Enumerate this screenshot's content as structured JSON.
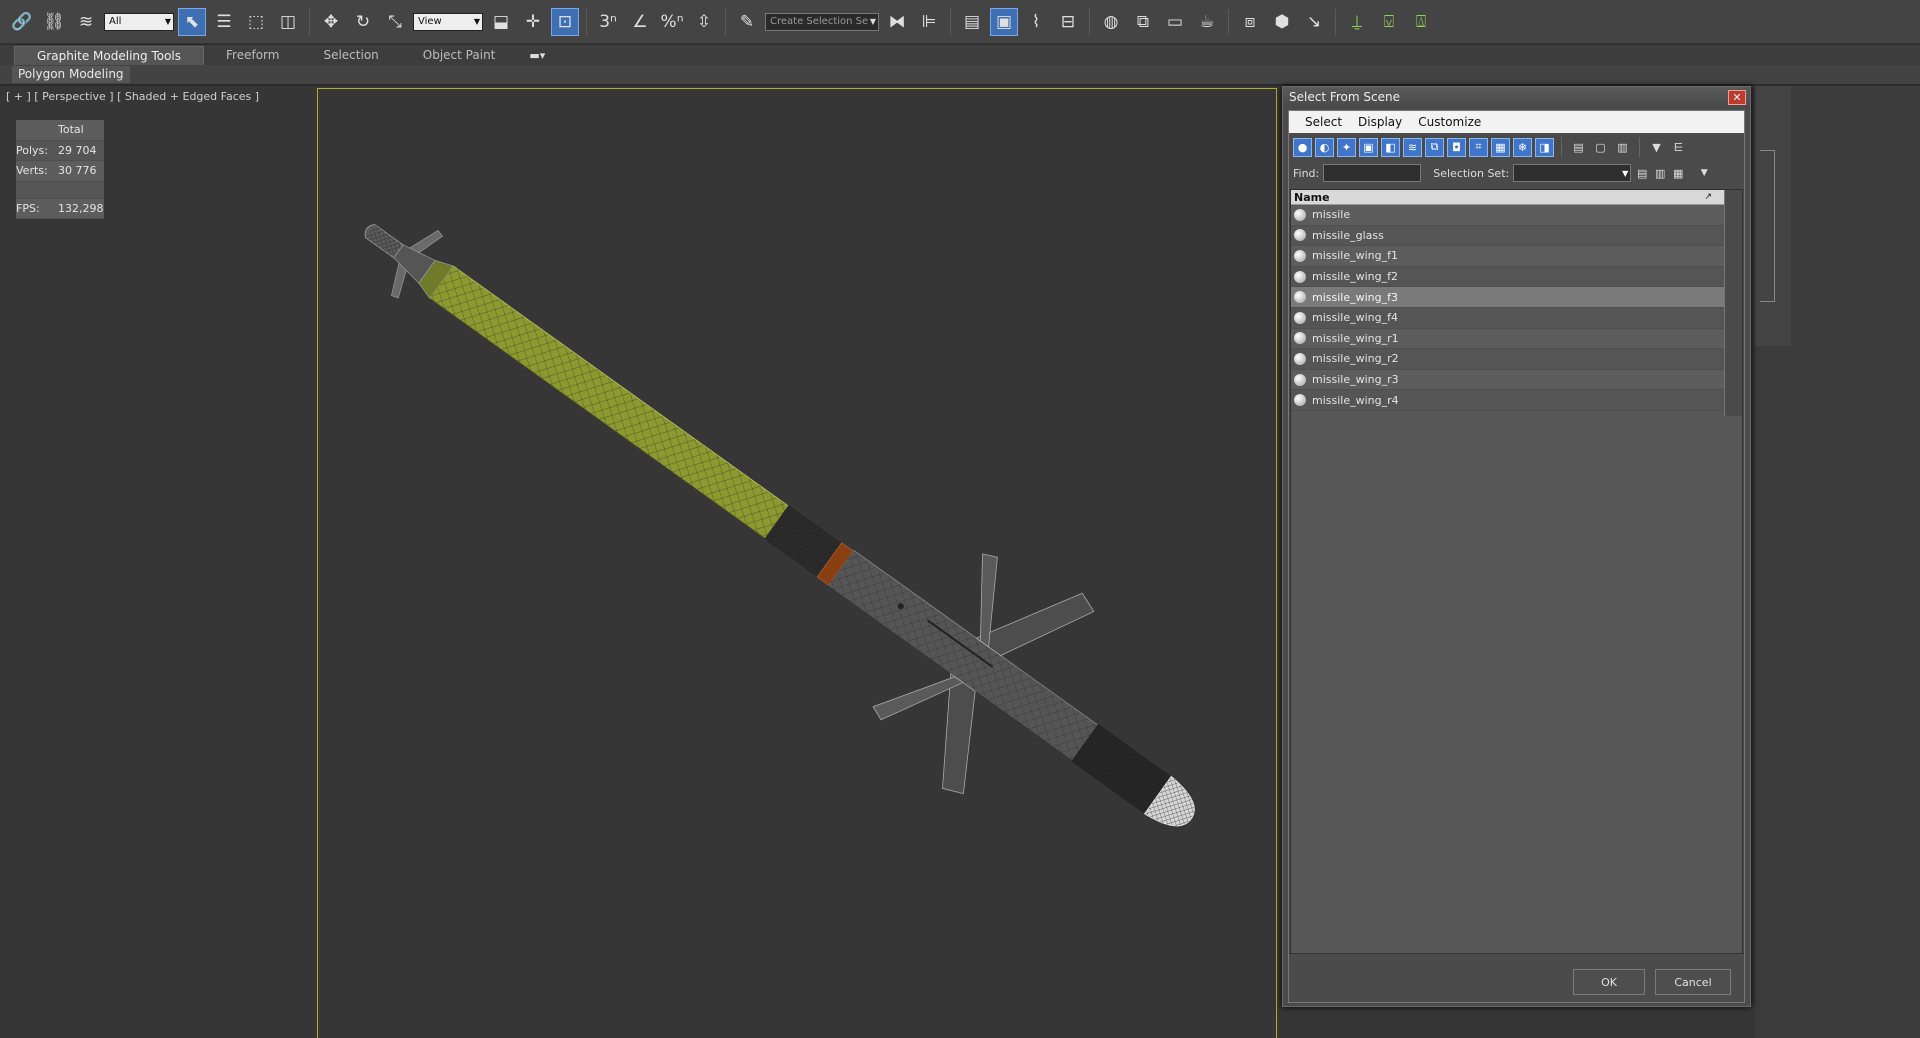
{
  "toolbar": {
    "selection_filter": "All",
    "reference_coord": "View",
    "selection_set_placeholder": "Create Selection Se",
    "snap_labels": [
      "3",
      "%",
      ""
    ]
  },
  "ribbon": {
    "tabs": [
      "Graphite Modeling Tools",
      "Freeform",
      "Selection",
      "Object Paint"
    ],
    "panel": "Polygon Modeling"
  },
  "viewport": {
    "label": "[ + ] [ Perspective ] [ Shaded + Edged Faces ]",
    "stats": {
      "header": "Total",
      "polys_label": "Polys:",
      "polys": "29 704",
      "verts_label": "Verts:",
      "verts": "30 776",
      "fps_label": "FPS:",
      "fps": "132,298"
    },
    "colors": {
      "stats": "#e5d84a",
      "safe_frame": "#b9a833",
      "missile_body": "#8a9a2e",
      "background": "#363636"
    }
  },
  "dialog": {
    "title": "Select From Scene",
    "menu": [
      "Select",
      "Display",
      "Customize"
    ],
    "find_label": "Find:",
    "find_value": "",
    "selection_set_label": "Selection Set:",
    "column_header": "Name",
    "objects": [
      "missile",
      "missile_glass",
      "missile_wing_f1",
      "missile_wing_f2",
      "missile_wing_f3",
      "missile_wing_f4",
      "missile_wing_r1",
      "missile_wing_r2",
      "missile_wing_r3",
      "missile_wing_r4"
    ],
    "selected_index": 4,
    "ok": "OK",
    "cancel": "Cancel"
  }
}
